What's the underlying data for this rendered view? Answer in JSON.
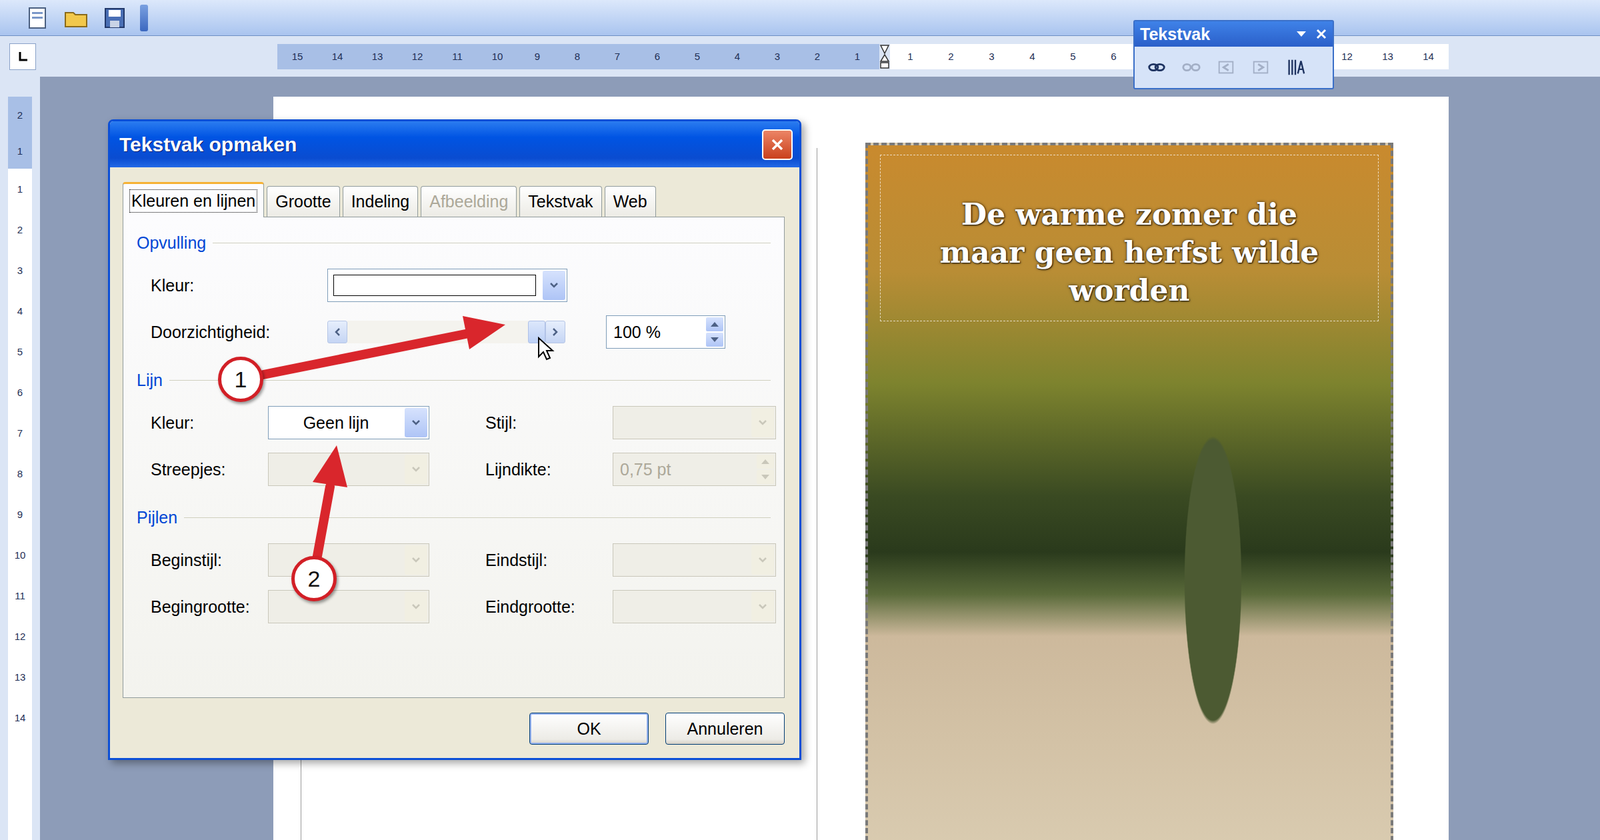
{
  "floating_toolbar": {
    "title": "Tekstvak",
    "buttons": [
      {
        "disabled": false
      },
      {
        "disabled": true
      },
      {
        "disabled": true
      },
      {
        "disabled": true
      },
      {
        "disabled": false
      }
    ]
  },
  "ruler": {
    "horizontal_left": [
      "15",
      "14",
      "13",
      "12",
      "11",
      "10",
      "9",
      "8",
      "7",
      "6",
      "5",
      "4",
      "3",
      "2",
      "1"
    ],
    "horizontal_right": [
      "1",
      "2",
      "3",
      "4",
      "5",
      "6"
    ],
    "horizontal_far": [
      "12",
      "13",
      "14"
    ],
    "vertical_top": [
      "2",
      "1"
    ],
    "vertical": [
      "1",
      "2",
      "3",
      "4",
      "5",
      "6",
      "7",
      "8",
      "9",
      "10",
      "11",
      "12",
      "13",
      "14"
    ]
  },
  "dialog": {
    "title": "Tekstvak opmaken",
    "tabs": [
      {
        "label": "Kleuren en lijnen",
        "selected": true,
        "disabled": false
      },
      {
        "label": "Grootte",
        "selected": false,
        "disabled": false
      },
      {
        "label": "Indeling",
        "selected": false,
        "disabled": false
      },
      {
        "label": "Afbeelding",
        "selected": false,
        "disabled": true
      },
      {
        "label": "Tekstvak",
        "selected": false,
        "disabled": false
      },
      {
        "label": "Web",
        "selected": false,
        "disabled": false
      }
    ],
    "fill": {
      "heading": "Opvulling",
      "color": {
        "label": "Kleur:",
        "swatch": "#ffffff"
      },
      "transparency": {
        "label": "Doorzichtigheid:",
        "level": 1,
        "value": "100 %"
      }
    },
    "line": {
      "heading": "Lijn",
      "fields": [
        {
          "label": "Kleur:",
          "value": "Geen lijn",
          "kind": "dropdown",
          "disabled": false
        },
        {
          "label": "Stijl:",
          "value": "",
          "kind": "dropdown",
          "disabled": true
        },
        {
          "label": "Streepjes:",
          "value": "",
          "kind": "dropdown",
          "disabled": true
        },
        {
          "label": "Lijndikte:",
          "value": "0,75 pt",
          "kind": "spinner",
          "disabled": true
        }
      ]
    },
    "arrows": {
      "heading": "Pijlen",
      "fields": [
        {
          "label": "Beginstijl:",
          "value": "",
          "kind": "dropdown",
          "disabled": true
        },
        {
          "label": "Eindstijl:",
          "value": "",
          "kind": "dropdown",
          "disabled": true
        },
        {
          "label": "Begingrootte:",
          "value": "",
          "kind": "dropdown",
          "disabled": true
        },
        {
          "label": "Eindgrootte:",
          "value": "",
          "kind": "dropdown",
          "disabled": true
        }
      ]
    },
    "buttons": [
      {
        "label": "OK",
        "default": true
      },
      {
        "label": "Annuleren",
        "default": false
      }
    ]
  },
  "textbox": {
    "lines": [
      "De warme zomer die",
      "maar geen herfst wilde",
      "worden"
    ]
  },
  "callouts": [
    {
      "number": "1"
    },
    {
      "number": "2"
    }
  ]
}
